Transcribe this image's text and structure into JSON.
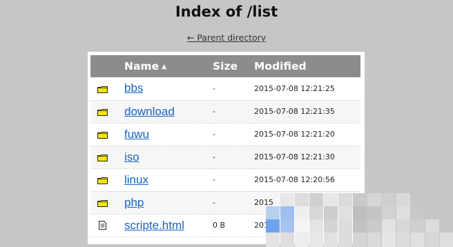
{
  "page": {
    "title": "Index of /list",
    "parent_link": "← Parent directory"
  },
  "table": {
    "headers": {
      "name": "Name",
      "sort_indicator": "▲",
      "size": "Size",
      "modified": "Modified"
    },
    "rows": [
      {
        "type": "folder",
        "name": "bbs",
        "size": "-",
        "modified": "2015-07-08 12:21:25"
      },
      {
        "type": "folder",
        "name": "download",
        "size": "-",
        "modified": "2015-07-08 12:21:35"
      },
      {
        "type": "folder",
        "name": "fuwu",
        "size": "-",
        "modified": "2015-07-08 12:21:20"
      },
      {
        "type": "folder",
        "name": "iso",
        "size": "-",
        "modified": "2015-07-08 12:21:30"
      },
      {
        "type": "folder",
        "name": "linux",
        "size": "-",
        "modified": "2015-07-08 12:20:56"
      },
      {
        "type": "folder",
        "name": "php",
        "size": "-",
        "modified": "2015"
      },
      {
        "type": "file",
        "name": "scripte.html",
        "size": "0 B",
        "modified": "201"
      }
    ]
  },
  "colors": {
    "background": "#c6c6c6",
    "header_bar": "#8c8c8c",
    "link": "#1a63c4",
    "folder_fill": "#f2e600"
  },
  "icons": {
    "folder": "folder-icon",
    "file": "file-icon"
  }
}
